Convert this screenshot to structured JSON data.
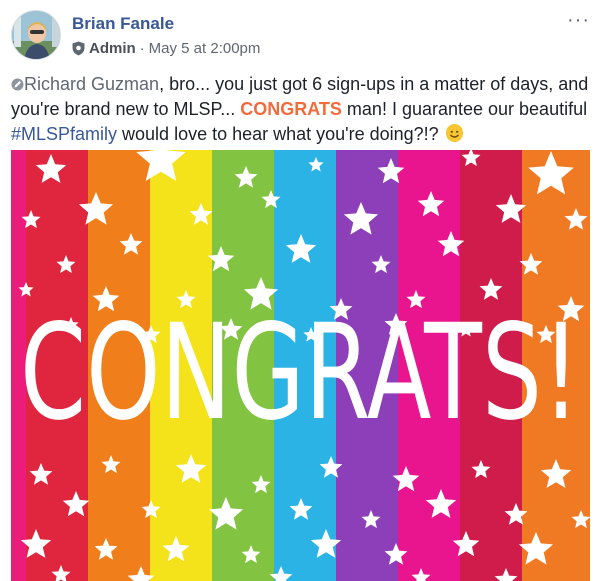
{
  "post": {
    "author": "Brian Fanale",
    "role": "Admin",
    "separator": "·",
    "timestamp": "May 5 at 2:00pm",
    "more_icon": "···",
    "text": {
      "mention": "Richard Guzman",
      "part1": ", bro... you just got 6 sign-ups in a matter of days, and you're brand new to MLSP... ",
      "highlight": "CONGRATS",
      "part2": " man! I guarantee our beautiful ",
      "hashtag": "#MLSPfamily",
      "part3": " would love to hear what you're doing?!? "
    },
    "image": {
      "headline": "CONGRATS!",
      "stripe_colors": [
        "#ec1c7a",
        "#e0263f",
        "#f07f1b",
        "#f4e31a",
        "#82c341",
        "#2bb3e6",
        "#8c3fb8",
        "#e9158f",
        "#cf1c4a",
        "#f07a23"
      ]
    }
  }
}
